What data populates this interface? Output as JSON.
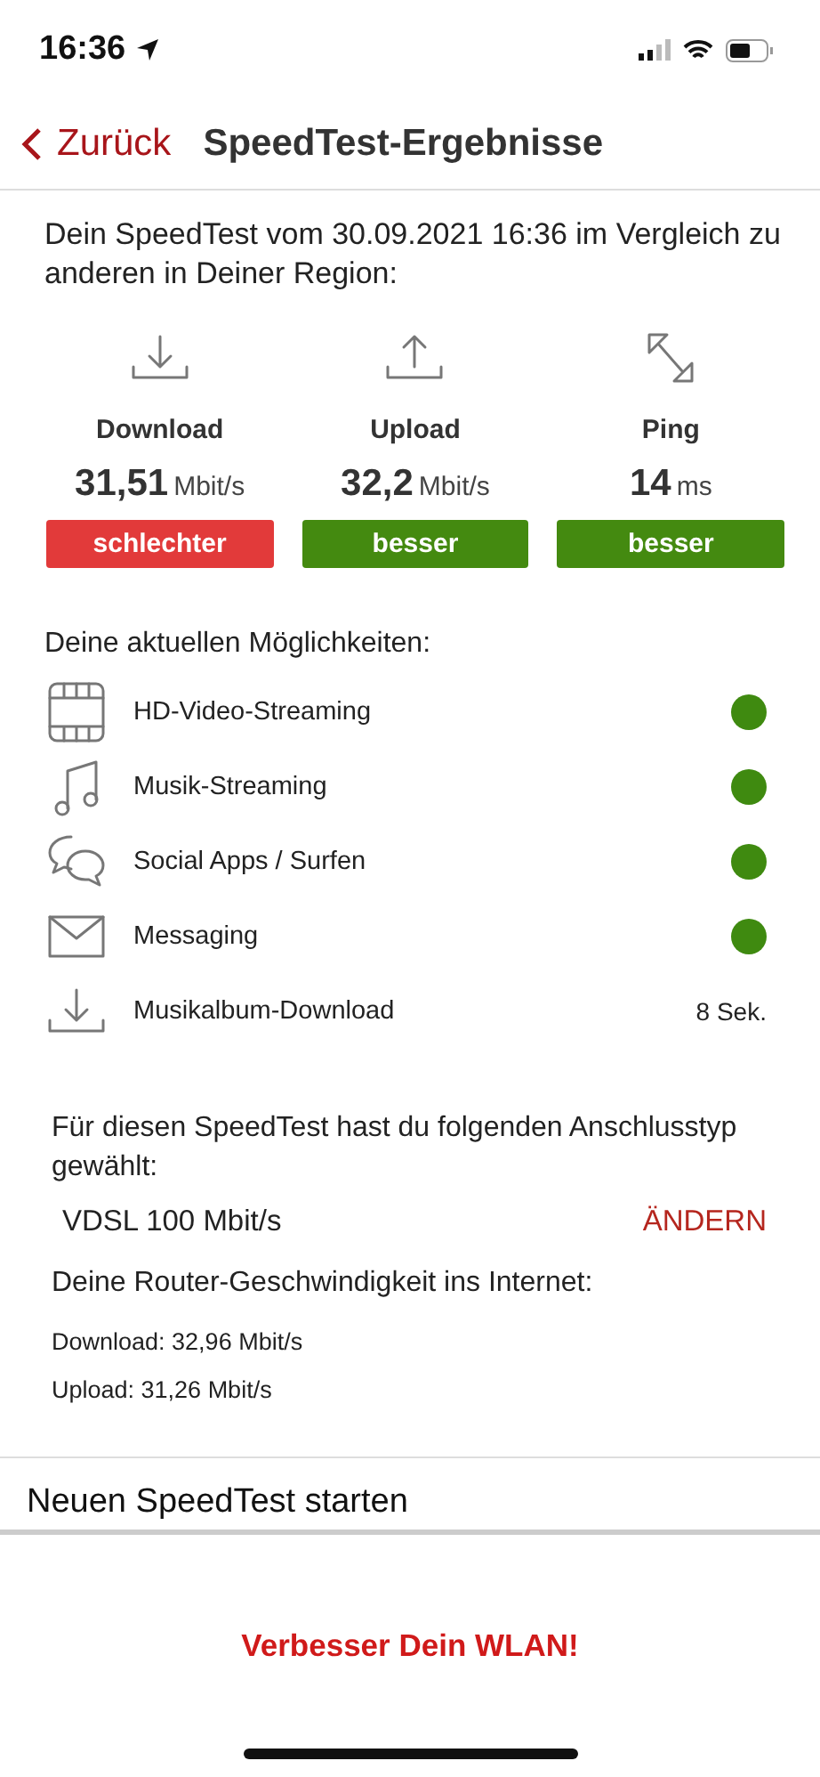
{
  "status_bar": {
    "time": "16:36"
  },
  "nav": {
    "back": "Zurück",
    "title": "SpeedTest-Ergebnisse"
  },
  "intro": "Dein SpeedTest vom 30.09.2021 16:36 im Vergleich zu anderen in Deiner Region:",
  "metrics": [
    {
      "kind": "download",
      "label": "Download",
      "value": "31,51",
      "unit": "Mbit/s",
      "verdict": "schlechter",
      "color": "#e23a3a"
    },
    {
      "kind": "upload",
      "label": "Upload",
      "value": "32,2",
      "unit": "Mbit/s",
      "verdict": "besser",
      "color": "#448a10"
    },
    {
      "kind": "ping",
      "label": "Ping",
      "value": "14",
      "unit": "ms",
      "verdict": "besser",
      "color": "#448a10"
    }
  ],
  "capabilities": {
    "title": "Deine aktuellen Möglichkeiten:",
    "items": [
      {
        "kind": "video",
        "label": "HD-Video-Streaming",
        "color": "#3f8a10"
      },
      {
        "kind": "music",
        "label": "Musik-Streaming",
        "color": "#3f8a10"
      },
      {
        "kind": "social",
        "label": "Social Apps / Surfen",
        "color": "#3f8a10"
      },
      {
        "kind": "mail",
        "label": "Messaging",
        "color": "#3f8a10"
      },
      {
        "kind": "download",
        "label": "Musikalbum-Download",
        "value": "8 Sek."
      }
    ]
  },
  "connection": {
    "text": "Für diesen SpeedTest hast du folgenden Anschlusstyp gewählt:",
    "type": "VDSL 100 Mbit/s",
    "change": "ÄNDERN"
  },
  "router": {
    "title": "Deine Router-Geschwindigkeit ins Internet:",
    "lines": [
      "Download: 32,96 Mbit/s",
      "Upload: 31,26 Mbit/s"
    ]
  },
  "start": "Neuen SpeedTest starten",
  "improve_link": "Verbesser Dein WLAN!"
}
